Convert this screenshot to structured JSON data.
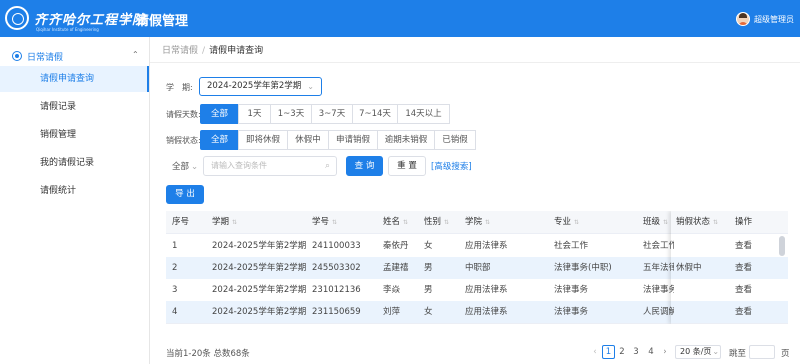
{
  "header": {
    "school_name": "齐齐哈尔工程学院",
    "school_name_en": "Qiqihar Institute of Engineering",
    "app_title": "请假管理",
    "user_name": "超级管理员",
    "brand_color": "#1e7fe8"
  },
  "sidebar": {
    "group_label": "日常请假",
    "group_icon": "leave-icon",
    "items": [
      {
        "label": "请假申请查询",
        "active": true
      },
      {
        "label": "请假记录",
        "active": false
      },
      {
        "label": "销假管理",
        "active": false
      },
      {
        "label": "我的请假记录",
        "active": false
      },
      {
        "label": "请假统计",
        "active": false
      }
    ]
  },
  "breadcrumb": {
    "parent": "日常请假",
    "separator": "/",
    "current": "请假申请查询"
  },
  "filters": {
    "semester_label": "学　期:",
    "semester_value": "2024-2025学年第2学期",
    "days_label": "请假天数:",
    "days_options": [
      "全部",
      "1天",
      "1~3天",
      "3~7天",
      "7~14天",
      "14天以上"
    ],
    "days_selected": "全部",
    "cancel_label": "销假状态:",
    "cancel_options": [
      "全部",
      "即将休假",
      "休假中",
      "申请销假",
      "逾期未销假",
      "已销假"
    ],
    "cancel_selected": "全部",
    "scope_value": "全部",
    "search_placeholder": "请输入查询条件",
    "query_button": "查 询",
    "reset_button": "重 置",
    "advanced_link": "[高级搜索]",
    "export_button": "导 出"
  },
  "table": {
    "columns": [
      "序号",
      "学期",
      "学号",
      "姓名",
      "性别",
      "学院",
      "专业",
      "班级",
      "销假状态",
      "操作"
    ],
    "rows": [
      {
        "no": "1",
        "semester": "2024-2025学年第2学期",
        "student_id": "241100033",
        "name": "秦依丹",
        "gender": "女",
        "college": "应用法律系",
        "major": "社会工作",
        "class": "社会工作",
        "status": "",
        "action": "查看"
      },
      {
        "no": "2",
        "semester": "2024-2025学年第2学期",
        "student_id": "245503302",
        "name": "孟建禧",
        "gender": "男",
        "college": "中职部",
        "major": "法律事务(中职)",
        "class": "五年法律",
        "status": "休假中",
        "action": "查看"
      },
      {
        "no": "3",
        "semester": "2024-2025学年第2学期",
        "student_id": "231012136",
        "name": "李焱",
        "gender": "男",
        "college": "应用法律系",
        "major": "法律事务",
        "class": "法律事务",
        "status": "",
        "action": "查看"
      },
      {
        "no": "4",
        "semester": "2024-2025学年第2学期",
        "student_id": "231150659",
        "name": "刘萍",
        "gender": "女",
        "college": "应用法律系",
        "major": "法律事务",
        "class": "人民调解",
        "status": "",
        "action": "查看"
      }
    ]
  },
  "pagination": {
    "summary": "当前1-20条 总数68条",
    "prev_icon": "chevron-left-icon",
    "pages": [
      "1",
      "2",
      "3",
      "4"
    ],
    "current_page": "1",
    "next_icon": "chevron-right-icon",
    "page_size": "20 条/页",
    "goto_label": "跳至",
    "goto_suffix": "页"
  }
}
